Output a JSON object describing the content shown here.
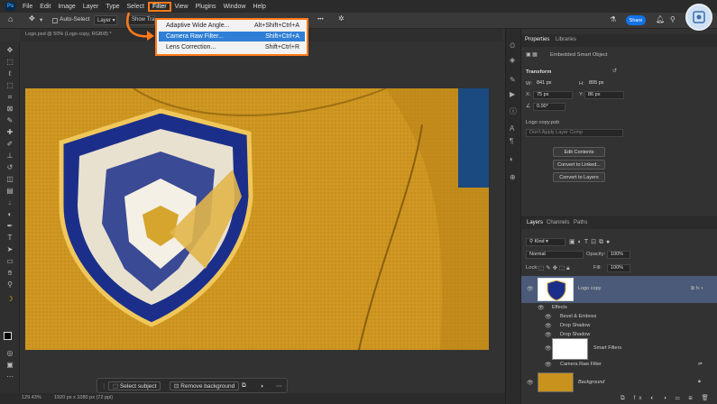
{
  "menubar": {
    "items": [
      "File",
      "Edit",
      "Image",
      "Layer",
      "Type",
      "Select",
      "Filter",
      "View",
      "Plugins",
      "Window",
      "Help"
    ]
  },
  "options": {
    "auto_select": "Auto-Select",
    "layer": "Layer",
    "show_transform": "Show Tra",
    "share": "Share"
  },
  "doc_tab": "Logo.psd @ 50% (Logo copy, RGB/8) *",
  "filter_menu": [
    {
      "label": "Adaptive Wide Angle...",
      "shortcut": "Alt+Shift+Ctrl+A"
    },
    {
      "label": "Camera Raw Filter...",
      "shortcut": "Shift+Ctrl+A"
    },
    {
      "label": "Lens Correction...",
      "shortcut": "Shift+Ctrl+R"
    }
  ],
  "context_bar": {
    "select_subject": "Select subject",
    "remove_background": "Remove background"
  },
  "status": {
    "zoom": "129.43%",
    "dims": "1920 px x 1080 px (72 ppi)"
  },
  "properties": {
    "tab1": "Properties",
    "tab2": "Libraries",
    "kind": "Embedded Smart Object",
    "transform": "Transform",
    "w_label": "W:",
    "w": "841 px",
    "h_label": "H:",
    "h": "895 px",
    "x_label": "X:",
    "x": "75 px",
    "y_label": "Y:",
    "y": "86 px",
    "angle": "0.00°",
    "file": "Logo copy.psb",
    "comp": "Don't Apply Layer Comp",
    "btn1": "Edit Contents",
    "btn2": "Convert to Linked...",
    "btn3": "Convert to Layers"
  },
  "layers_panel": {
    "tabs": [
      "Layers",
      "Channels",
      "Paths"
    ],
    "kind": "Kind",
    "blend": "Normal",
    "opacity_label": "Opacity:",
    "opacity": "100%",
    "lock_label": "Lock:",
    "fill_label": "Fill:",
    "fill": "100%",
    "layer1": "Logo copy",
    "effects": "Effects",
    "effect1": "Bevel & Emboss",
    "effect2": "Drop Shadow",
    "effect3": "Drop Shadow",
    "smart_filters": "Smart Filters",
    "camera_raw": "Camera Raw Filter",
    "background": "Background"
  }
}
